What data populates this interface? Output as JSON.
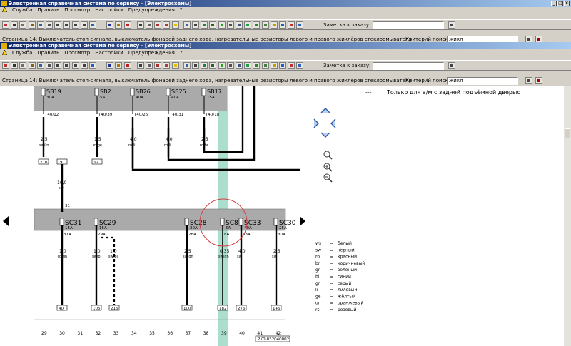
{
  "window_back": {
    "title": "Электронная справочная система по сервису - [Электросхемы]",
    "menu": [
      "Служба",
      "Править",
      "Просмотр",
      "Настройки",
      "Предупреждения",
      "?"
    ],
    "note_label": "Заметка к заказу:",
    "page_text": "Страница 14: Выключатель стоп-сигнала, выключатель фонарей заднего хода, нагревательные резисторы левого и правого жиклёров стеклоомывателя",
    "search_label": "Критерий поиска:",
    "search_value": "жикл"
  },
  "window_front": {
    "title": "Электронная справочная система по сервису - [Электросхемы]",
    "menu": [
      "Служба",
      "Править",
      "Просмотр",
      "Настройки",
      "Предупреждения",
      "?"
    ],
    "note_label": "Заметка к заказу:",
    "page_text": "Страница 14: Выключатель стоп-сигнала, выключатель фонарей заднего хода, нагревательные резисторы левого и правого жиклёров стеклоомывателя",
    "search_label": "Критерий поиска:",
    "search_value": "жикл"
  },
  "toolbar_icons": [
    "print-icon",
    "stop-icon",
    "page-icon",
    "edit-icon",
    "open-icon",
    "car-icon",
    "first-icon",
    "prev-icon",
    "next-icon",
    "last-icon",
    "jump-icon",
    "info-icon",
    "help-icon",
    "swap-icon",
    "settings-icon",
    "tool-icon",
    "component-icon",
    "diagnostic-icon",
    "warning-icon",
    "globe-icon",
    "save-icon",
    "parts-icon",
    "book-icon",
    "green-icon",
    "photo-icon",
    "doc-icon",
    "green2-icon",
    "leaf-icon",
    "tree-icon",
    "lamp-icon",
    "ball-icon",
    "flag-icon",
    "globe2-icon"
  ],
  "colors": {
    "title_start": "#0a246a",
    "title_end": "#a6caf0",
    "highlight": "#8fd3bb",
    "red": "#d04040",
    "bus": "#aaaaaa"
  },
  "schematic": {
    "note_dash": "---",
    "note_text": "Только для а/м с задней подъёмной дверью",
    "top_fuses": [
      {
        "name": "SB19",
        "amp": "30A",
        "term": "T40/12",
        "gauge": "2,5",
        "color": "sw/ro",
        "bottom": "210"
      },
      {
        "name": "SB2",
        "amp": "5A",
        "term": "T40/39",
        "gauge": "1,5",
        "color": "ro/ge",
        "bottom": "62"
      },
      {
        "name": "SB26",
        "amp": "40A",
        "term": "T40/26",
        "gauge": "4,0",
        "color": "ro/li"
      },
      {
        "name": "SB25",
        "amp": "40A",
        "term": "T40/31",
        "gauge": "4,0",
        "color": "ro/li"
      },
      {
        "name": "SB17",
        "amp": "15A",
        "term": "T40/18",
        "gauge": "2,5",
        "color": "ro/br"
      }
    ],
    "mid_wire": {
      "left": "9",
      "gauge": "10,0",
      "color": "sw",
      "term": "31"
    },
    "bottom_fuses": [
      {
        "name": "SC31",
        "amp": "15A",
        "term": "31A",
        "gauge": "1,0",
        "color": "ro/gn",
        "bottom": "40"
      },
      {
        "name": "SC29",
        "amp": "15A",
        "term": "29A",
        "gauge": "1,0",
        "color": "sw/bl",
        "bottom": "106"
      },
      {
        "name": "SC28",
        "amp": "20A",
        "term": "28A",
        "gauge": "2,5",
        "color": "sw/gn",
        "bottom": "100"
      },
      {
        "name": "SC8",
        "amp": "5A",
        "term": "8A",
        "gauge": "0,35",
        "color": "sw/gn",
        "bottom": "182"
      },
      {
        "name": "SC33",
        "amp": "40A",
        "term": "33A",
        "gauge": "4,0",
        "color": "sw",
        "bottom": "276"
      },
      {
        "name": "SC30",
        "amp": "25A",
        "term": "30A",
        "gauge": "2,5",
        "color": "sw",
        "bottom": "146"
      }
    ],
    "dashed_wire": {
      "gauge": "1,0",
      "color": "sw/bl",
      "bottom": "216"
    },
    "legend": [
      {
        "code": "ws",
        "eq": "=",
        "name": "белый"
      },
      {
        "code": "sw",
        "eq": "=",
        "name": "чёрный"
      },
      {
        "code": "ro",
        "eq": "=",
        "name": "красный"
      },
      {
        "code": "br",
        "eq": "=",
        "name": "коричневый"
      },
      {
        "code": "gn",
        "eq": "=",
        "name": "зелёный"
      },
      {
        "code": "bl",
        "eq": "=",
        "name": "синий"
      },
      {
        "code": "gr",
        "eq": "=",
        "name": "серый"
      },
      {
        "code": "li",
        "eq": "=",
        "name": "лиловый"
      },
      {
        "code": "ge",
        "eq": "=",
        "name": "жёлтый"
      },
      {
        "code": "or",
        "eq": "=",
        "name": "оранжевый"
      },
      {
        "code": "rs",
        "eq": "=",
        "name": "розовый"
      }
    ],
    "ruler": [
      "29",
      "30",
      "31",
      "32",
      "33",
      "34",
      "35",
      "36",
      "37",
      "38",
      "39",
      "40",
      "41",
      "42"
    ],
    "drawing_code": "2K0-032040002"
  }
}
